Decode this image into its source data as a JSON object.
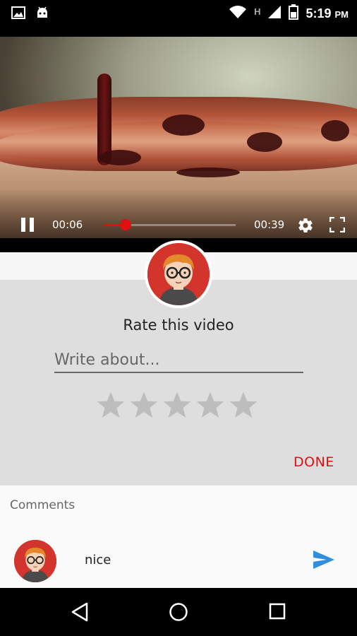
{
  "status_bar": {
    "time": "5:19",
    "ampm": "PM",
    "network_label": "H",
    "icons": [
      "image-icon",
      "android-icon",
      "wifi-icon",
      "signal-icon",
      "battery-icon"
    ]
  },
  "video": {
    "position": "00:06",
    "duration": "00:39",
    "progress_fraction": 0.17,
    "icons": [
      "pause-icon",
      "settings-gear-icon",
      "fullscreen-icon"
    ],
    "accent_color": "#e01010"
  },
  "rating": {
    "title": "Rate this video",
    "input_placeholder": "Write about...",
    "input_value": "",
    "stars_total": 5,
    "stars_selected": 0,
    "done_label": "DONE"
  },
  "comments": {
    "title": "Comments",
    "items": [
      {
        "text": "nice"
      }
    ],
    "send_icon": "send-icon",
    "send_color": "#2f8ee0"
  },
  "nav_bar": {
    "icons": [
      "back-icon",
      "home-icon",
      "recents-icon"
    ]
  }
}
